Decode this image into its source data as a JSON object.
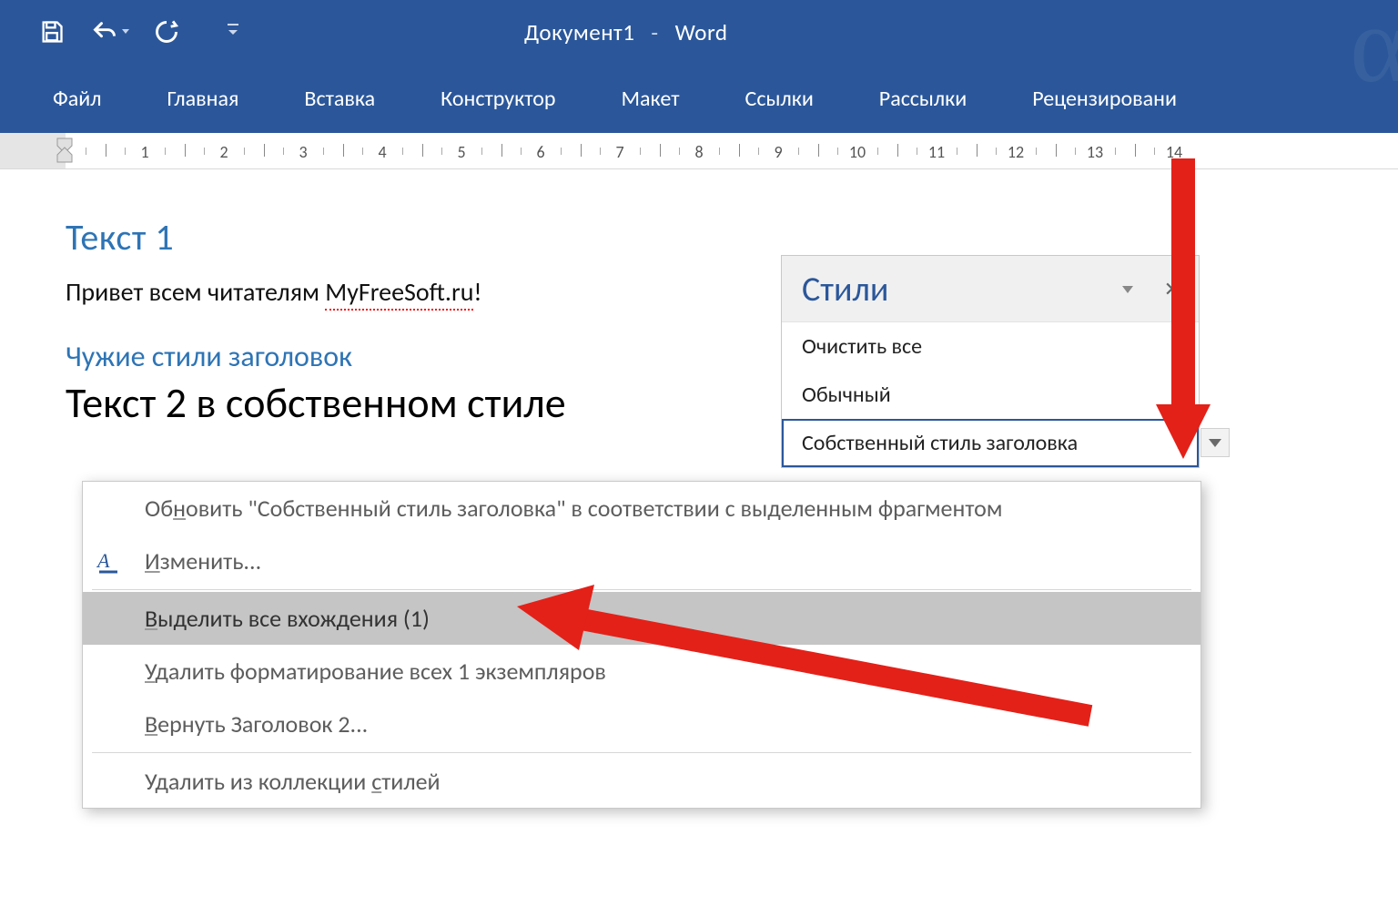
{
  "title": {
    "doc": "Документ1",
    "sep": "-",
    "app": "Word"
  },
  "ribbon_tabs": [
    "Файл",
    "Главная",
    "Вставка",
    "Конструктор",
    "Макет",
    "Ссылки",
    "Рассылки",
    "Рецензировани"
  ],
  "ruler_numbers": [
    1,
    2,
    3,
    4,
    5,
    6,
    7,
    8,
    9,
    10,
    11,
    12,
    13,
    14
  ],
  "document": {
    "heading1": "Текст 1",
    "body_prefix": "Привет всем читателям ",
    "body_site": "MyFreeSoft.ru",
    "body_suffix": "!",
    "heading_alt": "Чужие стили заголовок",
    "heading_own": "Текст 2 в собственном стиле"
  },
  "styles_pane": {
    "title": "Стили",
    "items": [
      {
        "label": "Очистить все",
        "pilcrow": false,
        "selected": false
      },
      {
        "label": "Обычный",
        "pilcrow": true,
        "selected": false
      },
      {
        "label": "Собственный стиль заголовка",
        "pilcrow": true,
        "selected": true
      }
    ]
  },
  "context_menu": {
    "items": [
      {
        "label": "Обновить \"Собственный стиль заголовка\" в соответствии с выделенным фрагментом",
        "ul_idx": 2,
        "icon": false
      },
      {
        "label": "Изменить...",
        "ul_idx": 0,
        "icon": true
      },
      {
        "sep": true
      },
      {
        "label": "Выделить все вхождения (1)",
        "ul_idx": 0,
        "highlight": true
      },
      {
        "label": "Удалить форматирование всех 1 экземпляров",
        "ul_idx": 0
      },
      {
        "label": "Вернуть Заголовок 2...",
        "ul_idx": 0
      },
      {
        "sep": true
      },
      {
        "label": "Удалить из коллекции стилей",
        "ul_idx": 21
      }
    ]
  }
}
